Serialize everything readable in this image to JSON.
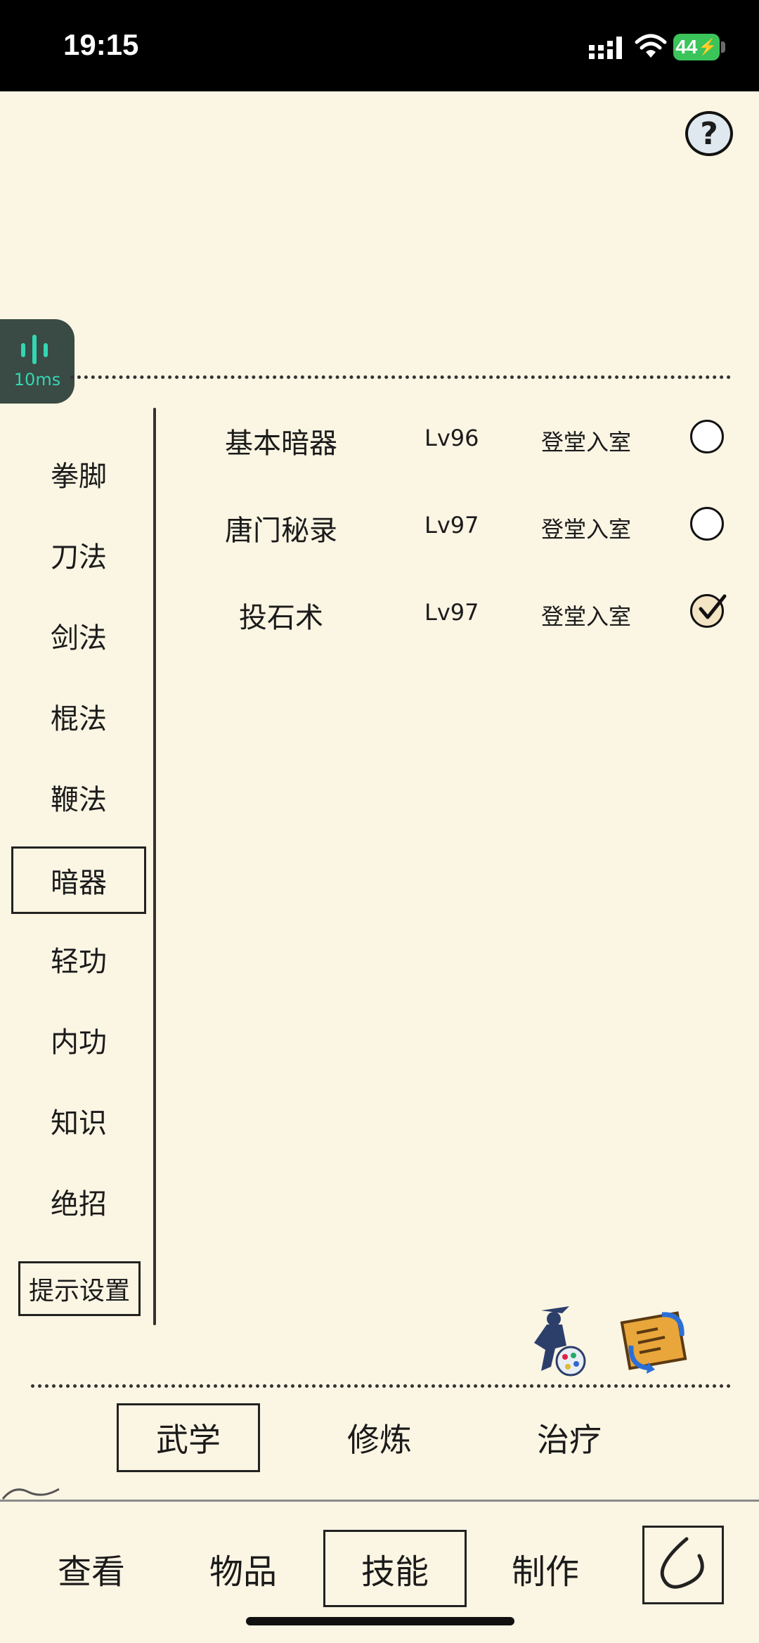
{
  "status_bar": {
    "time": "19:15",
    "battery": "44"
  },
  "help": {
    "label": "?"
  },
  "latency": {
    "value": "10ms"
  },
  "sidebar": {
    "items": [
      {
        "label": "拳脚"
      },
      {
        "label": "刀法"
      },
      {
        "label": "剑法"
      },
      {
        "label": "棍法"
      },
      {
        "label": "鞭法"
      },
      {
        "label": "暗器",
        "active": true
      },
      {
        "label": "轻功"
      },
      {
        "label": "内功"
      },
      {
        "label": "知识"
      },
      {
        "label": "绝招"
      }
    ],
    "hint_settings": "提示设置"
  },
  "skills": [
    {
      "name": "基本暗器",
      "level": "Lv96",
      "rank": "登堂入室",
      "selected": false
    },
    {
      "name": "唐门秘录",
      "level": "Lv97",
      "rank": "登堂入室",
      "selected": false
    },
    {
      "name": "投石术",
      "level": "Lv97",
      "rank": "登堂入室",
      "selected": true
    }
  ],
  "subtabs": [
    {
      "label": "武学",
      "active": true
    },
    {
      "label": "修炼"
    },
    {
      "label": "治疗"
    }
  ],
  "bottom_nav": [
    {
      "label": "查看"
    },
    {
      "label": "物品"
    },
    {
      "label": "技能",
      "active": true
    },
    {
      "label": "制作"
    }
  ],
  "colors": {
    "background": "#fbf5e3",
    "battery": "#3bc45a",
    "latency_text": "#33d6b2"
  }
}
